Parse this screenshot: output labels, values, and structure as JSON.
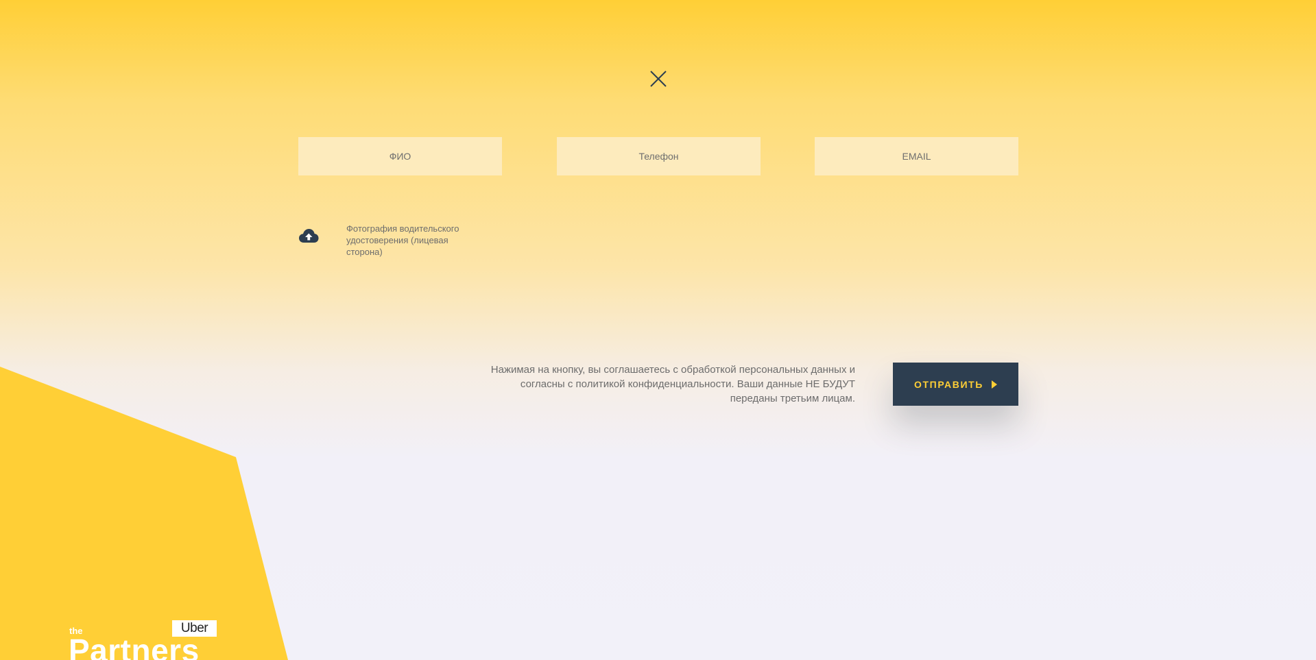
{
  "theme": {
    "accent": "#ffcf36",
    "button_bg": "#2d3e50",
    "field_bg": "#fdebbd",
    "text_muted": "#6c6c6c"
  },
  "close": {
    "icon": "close-icon"
  },
  "form": {
    "fields": [
      {
        "name": "name",
        "placeholder": "ФИО",
        "value": ""
      },
      {
        "name": "phone",
        "placeholder": "Телефон",
        "value": ""
      },
      {
        "name": "email",
        "placeholder": "EMAIL",
        "value": ""
      }
    ],
    "upload": {
      "icon": "cloud-upload-icon",
      "label": "Фотография водительского удостоверения (лицевая сторона)"
    },
    "consent_text": "Нажимая на кнопку, вы соглашаетесь с обработкой персональных данных и согласны с политикой конфиденциальности. Ваши данные НЕ БУДУТ переданы третьим лицам.",
    "submit_label": "ОТПРАВИТЬ",
    "submit_icon": "play-arrow-icon"
  },
  "logo": {
    "the": "the",
    "brand": "Uber",
    "partners": "Partners"
  }
}
